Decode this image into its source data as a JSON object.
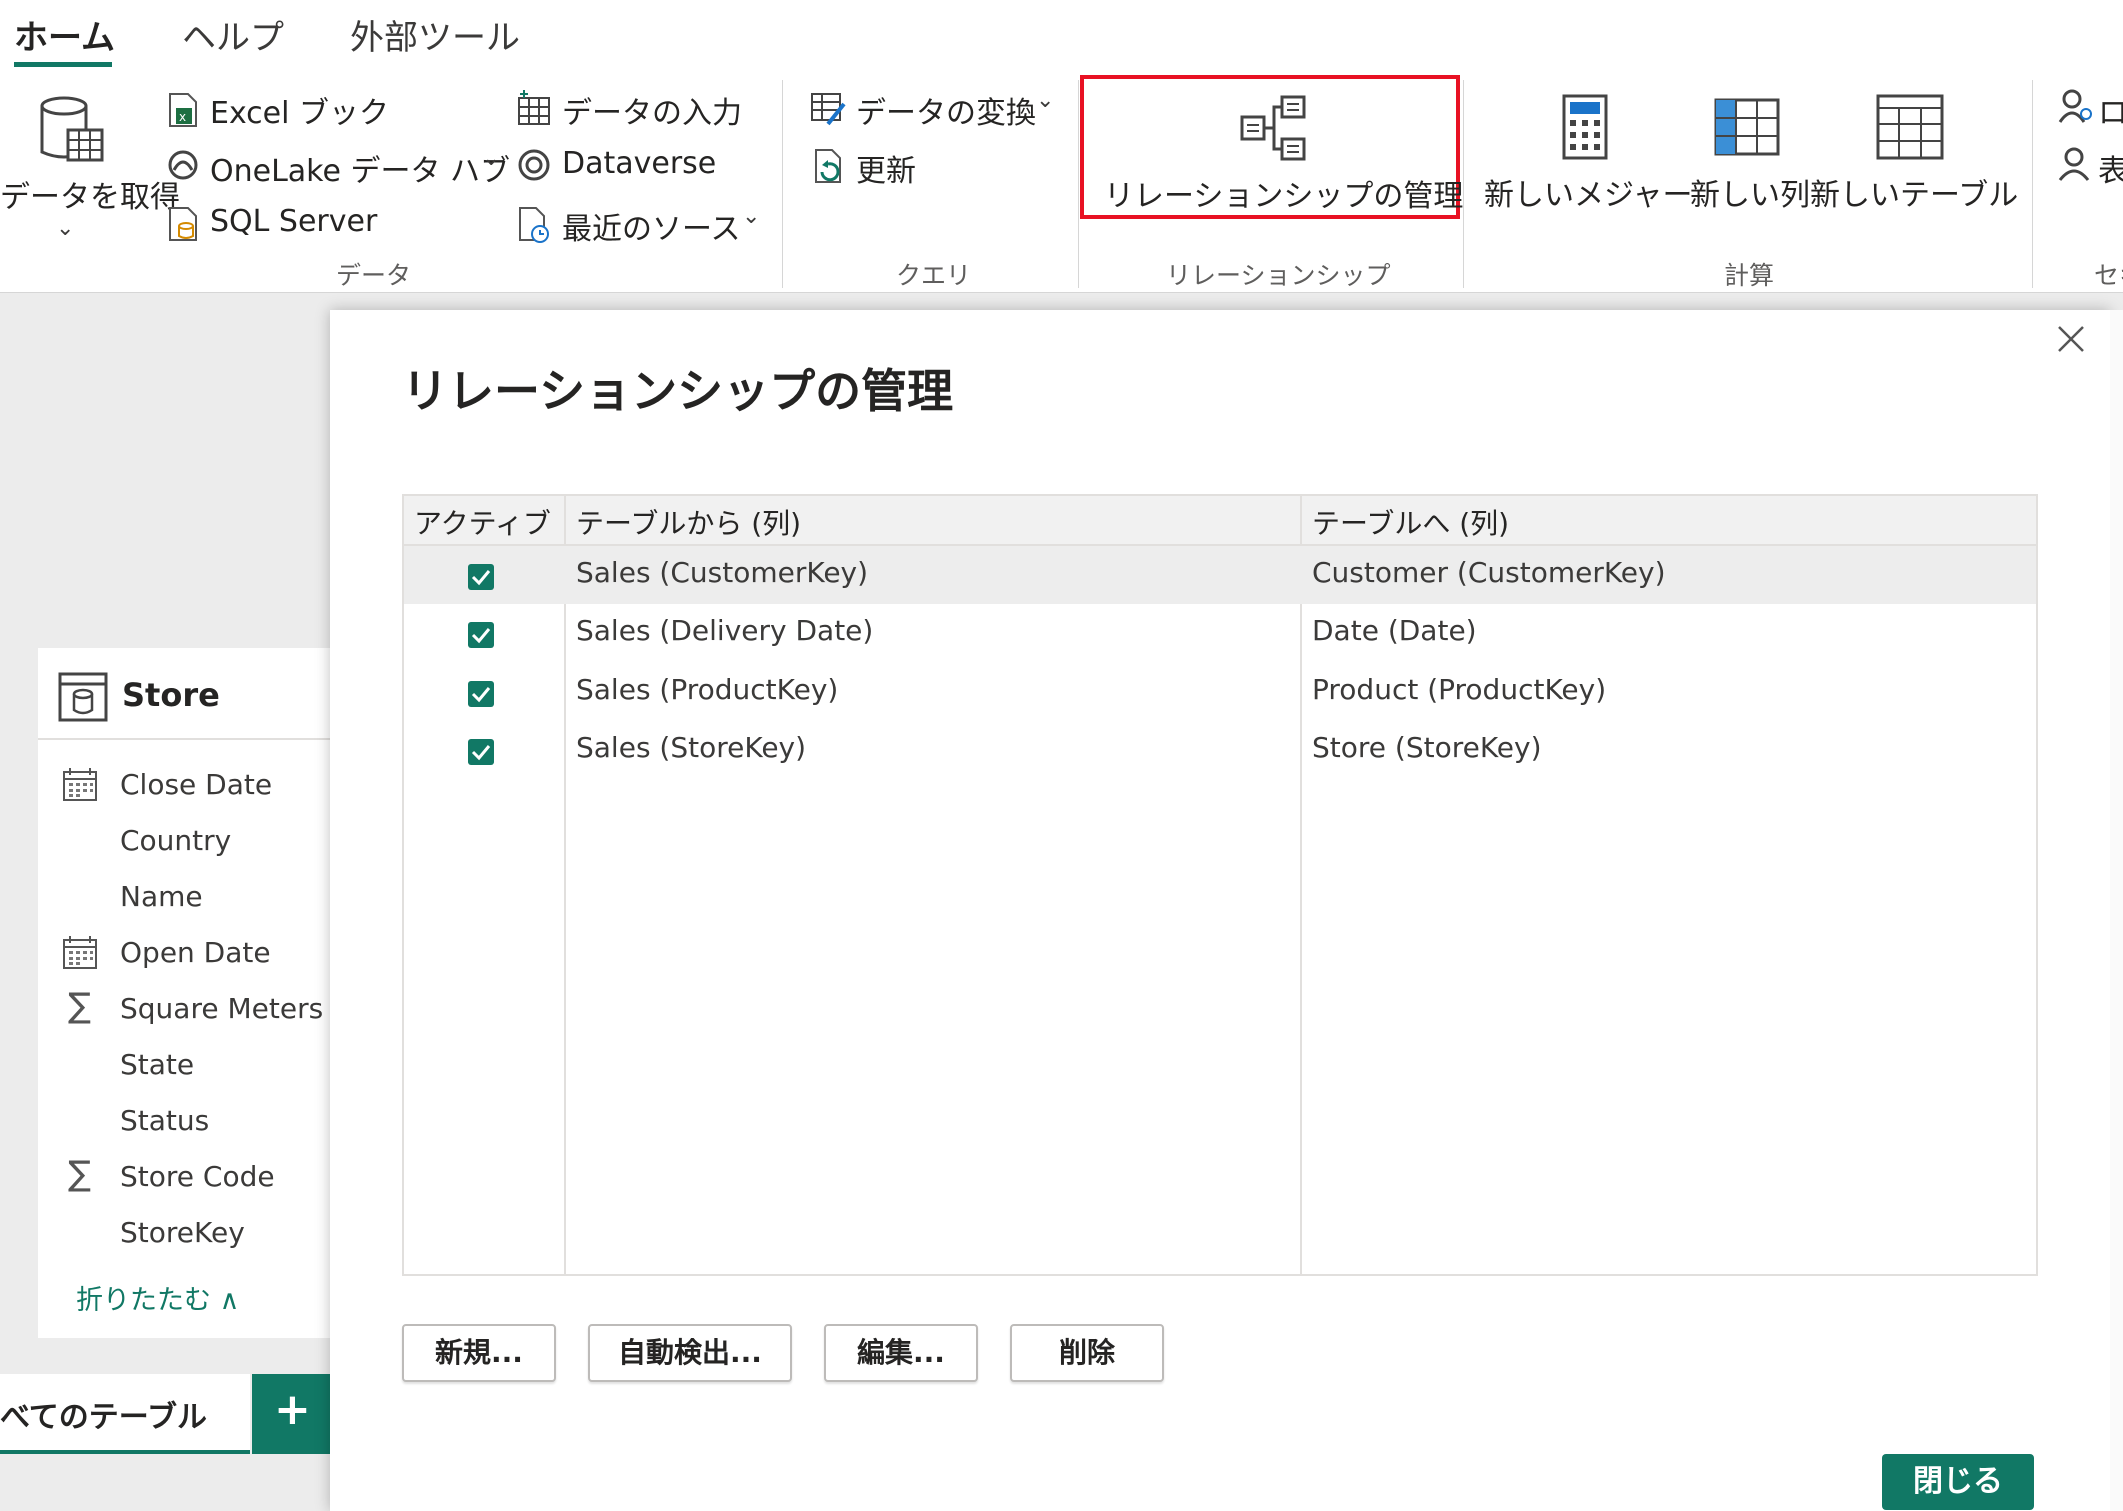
{
  "ribbon": {
    "tabs": [
      "ホーム",
      "ヘルプ",
      "外部ツール"
    ],
    "data_group": {
      "get_data": "データを取得",
      "excel": "Excel ブック",
      "onelake": "OneLake データ ハブ",
      "sql": "SQL Server",
      "enter_data": "データの入力",
      "dataverse": "Dataverse",
      "recent": "最近のソース",
      "label": "データ"
    },
    "query_group": {
      "transform": "データの変換",
      "refresh": "更新",
      "label": "クエリ"
    },
    "relationship_group": {
      "manage": "リレーションシップの管理",
      "label": "リレーションシップ"
    },
    "calc_group": {
      "new_measure": "新しいメジャー",
      "new_column": "新しい列",
      "new_table": "新しいテーブル",
      "label": "計算"
    },
    "security_group": {
      "item1": "ロ",
      "item2": "表",
      "label": "セキ"
    }
  },
  "left_panel": {
    "table_name": "Store",
    "fields": [
      {
        "name": "Close Date",
        "icon": "calendar-icon"
      },
      {
        "name": "Country",
        "icon": ""
      },
      {
        "name": "Name",
        "icon": ""
      },
      {
        "name": "Open Date",
        "icon": "calendar-icon"
      },
      {
        "name": "Square Meters",
        "icon": "sigma-icon"
      },
      {
        "name": "State",
        "icon": ""
      },
      {
        "name": "Status",
        "icon": ""
      },
      {
        "name": "Store Code",
        "icon": "sigma-icon"
      },
      {
        "name": "StoreKey",
        "icon": ""
      }
    ],
    "collapse": "折りたたむ ∧",
    "all_tables_tab": "べてのテーブル",
    "add_tab": "+"
  },
  "dialog": {
    "title": "リレーションシップの管理",
    "columns": [
      "アクティブ",
      "テーブルから (列)",
      "テーブルへ (列)"
    ],
    "rows": [
      {
        "active": true,
        "from": "Sales (CustomerKey)",
        "to": "Customer (CustomerKey)"
      },
      {
        "active": true,
        "from": "Sales (Delivery Date)",
        "to": "Date (Date)"
      },
      {
        "active": true,
        "from": "Sales (ProductKey)",
        "to": "Product (ProductKey)"
      },
      {
        "active": true,
        "from": "Sales (StoreKey)",
        "to": "Store (StoreKey)"
      }
    ],
    "buttons": {
      "new": "新規...",
      "autodetect": "自動検出...",
      "edit": "編集...",
      "delete": "削除"
    },
    "close": "閉じる"
  },
  "colors": {
    "accent": "#117865",
    "highlight_border": "#e81123"
  }
}
